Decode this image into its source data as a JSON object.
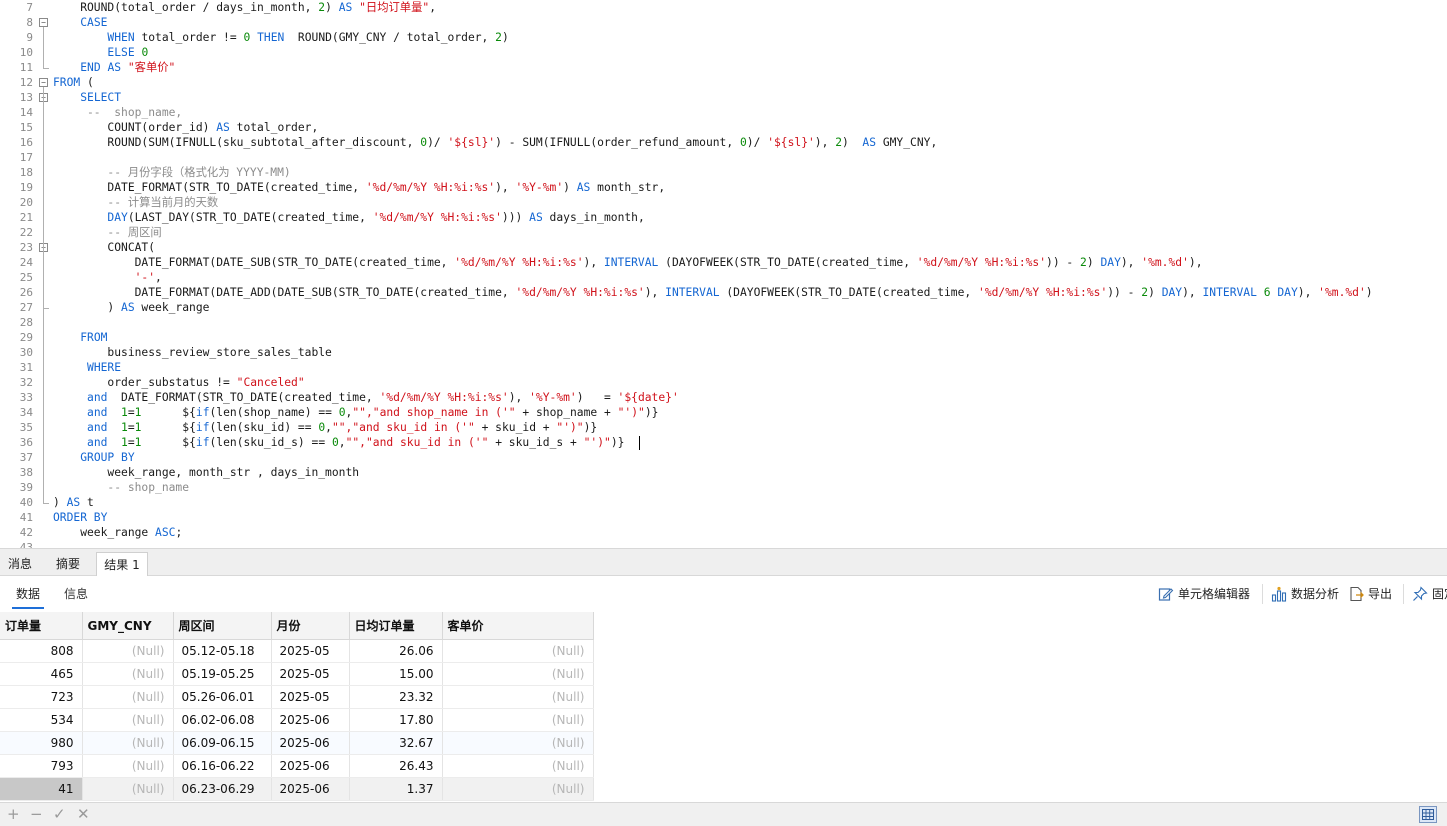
{
  "editor": {
    "lines": [
      {
        "n": "7",
        "segs": [
          {
            "t": "    ROUND(total_order / days_in_month, "
          },
          {
            "t": "2",
            "c": "num"
          },
          {
            "t": ") "
          },
          {
            "t": "AS",
            "c": "kw"
          },
          {
            "t": " "
          },
          {
            "t": "\"日均订单量\"",
            "c": "str"
          },
          {
            "t": ","
          }
        ]
      },
      {
        "n": "8",
        "segs": [
          {
            "t": "    "
          },
          {
            "t": "CASE",
            "c": "kw"
          }
        ]
      },
      {
        "n": "9",
        "segs": [
          {
            "t": "        "
          },
          {
            "t": "WHEN",
            "c": "kw"
          },
          {
            "t": " total_order != "
          },
          {
            "t": "0",
            "c": "num"
          },
          {
            "t": " "
          },
          {
            "t": "THEN",
            "c": "kw"
          },
          {
            "t": "  ROUND(GMY_CNY / total_order, "
          },
          {
            "t": "2",
            "c": "num"
          },
          {
            "t": ")"
          }
        ]
      },
      {
        "n": "10",
        "segs": [
          {
            "t": "        "
          },
          {
            "t": "ELSE",
            "c": "kw"
          },
          {
            "t": " "
          },
          {
            "t": "0",
            "c": "num"
          }
        ]
      },
      {
        "n": "11",
        "segs": [
          {
            "t": "    "
          },
          {
            "t": "END",
            "c": "kw"
          },
          {
            "t": " "
          },
          {
            "t": "AS",
            "c": "kw"
          },
          {
            "t": " "
          },
          {
            "t": "\"客单价\"",
            "c": "str"
          }
        ]
      },
      {
        "n": "12",
        "segs": [
          {
            "t": "FROM",
            "c": "kw"
          },
          {
            "t": " ("
          }
        ]
      },
      {
        "n": "13",
        "segs": [
          {
            "t": "    "
          },
          {
            "t": "SELECT",
            "c": "kw"
          }
        ]
      },
      {
        "n": "14",
        "segs": [
          {
            "t": "     --  shop_name,",
            "c": "cm"
          }
        ]
      },
      {
        "n": "15",
        "segs": [
          {
            "t": "        COUNT(order_id) "
          },
          {
            "t": "AS",
            "c": "kw"
          },
          {
            "t": " total_order,"
          }
        ]
      },
      {
        "n": "16",
        "segs": [
          {
            "t": "        ROUND(SUM(IFNULL(sku_subtotal_after_discount, "
          },
          {
            "t": "0",
            "c": "num"
          },
          {
            "t": ")/ "
          },
          {
            "t": "'${sl}'",
            "c": "str"
          },
          {
            "t": ") - SUM(IFNULL(order_refund_amount, "
          },
          {
            "t": "0",
            "c": "num"
          },
          {
            "t": ")/ "
          },
          {
            "t": "'${sl}'",
            "c": "str"
          },
          {
            "t": "), "
          },
          {
            "t": "2",
            "c": "num"
          },
          {
            "t": ")  "
          },
          {
            "t": "AS",
            "c": "kw"
          },
          {
            "t": " GMY_CNY,"
          }
        ]
      },
      {
        "n": "17",
        "segs": [
          {
            "t": ""
          }
        ]
      },
      {
        "n": "18",
        "segs": [
          {
            "t": "        -- 月份字段（格式化为 YYYY-MM)",
            "c": "cm"
          }
        ]
      },
      {
        "n": "19",
        "segs": [
          {
            "t": "        DATE_FORMAT(STR_TO_DATE(created_time, "
          },
          {
            "t": "'%d/%m/%Y %H:%i:%s'",
            "c": "str"
          },
          {
            "t": "), "
          },
          {
            "t": "'%Y-%m'",
            "c": "str"
          },
          {
            "t": ") "
          },
          {
            "t": "AS",
            "c": "kw"
          },
          {
            "t": " month_str,"
          }
        ]
      },
      {
        "n": "20",
        "segs": [
          {
            "t": "        -- 计算当前月的天数",
            "c": "cm"
          }
        ]
      },
      {
        "n": "21",
        "segs": [
          {
            "t": "        "
          },
          {
            "t": "DAY",
            "c": "kw"
          },
          {
            "t": "(LAST_DAY(STR_TO_DATE(created_time, "
          },
          {
            "t": "'%d/%m/%Y %H:%i:%s'",
            "c": "str"
          },
          {
            "t": "))) "
          },
          {
            "t": "AS",
            "c": "kw"
          },
          {
            "t": " days_in_month,"
          }
        ]
      },
      {
        "n": "22",
        "segs": [
          {
            "t": "        -- 周区间",
            "c": "cm"
          }
        ]
      },
      {
        "n": "23",
        "segs": [
          {
            "t": "        CONCAT("
          }
        ]
      },
      {
        "n": "24",
        "segs": [
          {
            "t": "            DATE_FORMAT(DATE_SUB(STR_TO_DATE(created_time, "
          },
          {
            "t": "'%d/%m/%Y %H:%i:%s'",
            "c": "str"
          },
          {
            "t": "), "
          },
          {
            "t": "INTERVAL",
            "c": "kw"
          },
          {
            "t": " (DAYOFWEEK(STR_TO_DATE(created_time, "
          },
          {
            "t": "'%d/%m/%Y %H:%i:%s'",
            "c": "str"
          },
          {
            "t": ")) - "
          },
          {
            "t": "2",
            "c": "num"
          },
          {
            "t": ") "
          },
          {
            "t": "DAY",
            "c": "kw"
          },
          {
            "t": "), "
          },
          {
            "t": "'%m.%d'",
            "c": "str"
          },
          {
            "t": "),"
          }
        ]
      },
      {
        "n": "25",
        "segs": [
          {
            "t": "            "
          },
          {
            "t": "'-'",
            "c": "str"
          },
          {
            "t": ","
          }
        ]
      },
      {
        "n": "26",
        "segs": [
          {
            "t": "            DATE_FORMAT(DATE_ADD(DATE_SUB(STR_TO_DATE(created_time, "
          },
          {
            "t": "'%d/%m/%Y %H:%i:%s'",
            "c": "str"
          },
          {
            "t": "), "
          },
          {
            "t": "INTERVAL",
            "c": "kw"
          },
          {
            "t": " (DAYOFWEEK(STR_TO_DATE(created_time, "
          },
          {
            "t": "'%d/%m/%Y %H:%i:%s'",
            "c": "str"
          },
          {
            "t": ")) - "
          },
          {
            "t": "2",
            "c": "num"
          },
          {
            "t": ") "
          },
          {
            "t": "DAY",
            "c": "kw"
          },
          {
            "t": "), "
          },
          {
            "t": "INTERVAL",
            "c": "kw"
          },
          {
            "t": " "
          },
          {
            "t": "6",
            "c": "num"
          },
          {
            "t": " "
          },
          {
            "t": "DAY",
            "c": "kw"
          },
          {
            "t": "), "
          },
          {
            "t": "'%m.%d'",
            "c": "str"
          },
          {
            "t": ")"
          }
        ]
      },
      {
        "n": "27",
        "segs": [
          {
            "t": "        ) "
          },
          {
            "t": "AS",
            "c": "kw"
          },
          {
            "t": " week_range"
          }
        ]
      },
      {
        "n": "28",
        "segs": [
          {
            "t": ""
          }
        ]
      },
      {
        "n": "29",
        "segs": [
          {
            "t": "    "
          },
          {
            "t": "FROM",
            "c": "kw"
          }
        ]
      },
      {
        "n": "30",
        "segs": [
          {
            "t": "        business_review_store_sales_table"
          }
        ]
      },
      {
        "n": "31",
        "segs": [
          {
            "t": "     "
          },
          {
            "t": "WHERE",
            "c": "kw"
          }
        ]
      },
      {
        "n": "32",
        "segs": [
          {
            "t": "        order_substatus != "
          },
          {
            "t": "\"Canceled\"",
            "c": "str"
          }
        ]
      },
      {
        "n": "33",
        "segs": [
          {
            "t": "     "
          },
          {
            "t": "and",
            "c": "kw"
          },
          {
            "t": "  DATE_FORMAT(STR_TO_DATE(created_time, "
          },
          {
            "t": "'%d/%m/%Y %H:%i:%s'",
            "c": "str"
          },
          {
            "t": "), "
          },
          {
            "t": "'%Y-%m'",
            "c": "str"
          },
          {
            "t": ")   = "
          },
          {
            "t": "'${date}'",
            "c": "str"
          }
        ]
      },
      {
        "n": "34",
        "segs": [
          {
            "t": "     "
          },
          {
            "t": "and",
            "c": "kw"
          },
          {
            "t": "  "
          },
          {
            "t": "1",
            "c": "num"
          },
          {
            "t": "="
          },
          {
            "t": "1",
            "c": "num"
          },
          {
            "t": "      ${"
          },
          {
            "t": "if",
            "c": "kw"
          },
          {
            "t": "(len(shop_name) == "
          },
          {
            "t": "0",
            "c": "num"
          },
          {
            "t": ","
          },
          {
            "t": "\"\",\"and shop_name in ('\"",
            "c": "str"
          },
          {
            "t": " + shop_name + "
          },
          {
            "t": "\"')\"",
            "c": "str"
          },
          {
            "t": ")}"
          }
        ]
      },
      {
        "n": "35",
        "segs": [
          {
            "t": "     "
          },
          {
            "t": "and",
            "c": "kw"
          },
          {
            "t": "  "
          },
          {
            "t": "1",
            "c": "num"
          },
          {
            "t": "="
          },
          {
            "t": "1",
            "c": "num"
          },
          {
            "t": "      ${"
          },
          {
            "t": "if",
            "c": "kw"
          },
          {
            "t": "(len(sku_id) == "
          },
          {
            "t": "0",
            "c": "num"
          },
          {
            "t": ","
          },
          {
            "t": "\"\",\"and sku_id in ('\"",
            "c": "str"
          },
          {
            "t": " + sku_id + "
          },
          {
            "t": "\"')\"",
            "c": "str"
          },
          {
            "t": ")}"
          }
        ]
      },
      {
        "n": "36",
        "segs": [
          {
            "t": "     "
          },
          {
            "t": "and",
            "c": "kw"
          },
          {
            "t": "  "
          },
          {
            "t": "1",
            "c": "num"
          },
          {
            "t": "="
          },
          {
            "t": "1",
            "c": "num"
          },
          {
            "t": "      ${"
          },
          {
            "t": "if",
            "c": "kw"
          },
          {
            "t": "(len(sku_id_s) == "
          },
          {
            "t": "0",
            "c": "num"
          },
          {
            "t": ","
          },
          {
            "t": "\"\",\"and sku_id in ('\"",
            "c": "str"
          },
          {
            "t": " + sku_id_s + "
          },
          {
            "t": "\"')\"",
            "c": "str"
          },
          {
            "t": ")}"
          }
        ]
      },
      {
        "n": "37",
        "segs": [
          {
            "t": "    "
          },
          {
            "t": "GROUP BY",
            "c": "kw"
          }
        ]
      },
      {
        "n": "38",
        "segs": [
          {
            "t": "        week_range, month_str , days_in_month"
          }
        ]
      },
      {
        "n": "39",
        "segs": [
          {
            "t": "        -- shop_name",
            "c": "cm"
          }
        ]
      },
      {
        "n": "40",
        "segs": [
          {
            "t": ") "
          },
          {
            "t": "AS",
            "c": "kw"
          },
          {
            "t": " t"
          }
        ]
      },
      {
        "n": "41",
        "segs": [
          {
            "t": "ORDER BY",
            "c": "kw"
          }
        ]
      },
      {
        "n": "42",
        "segs": [
          {
            "t": "    week_range "
          },
          {
            "t": "ASC",
            "c": "kw"
          },
          {
            "t": ";"
          }
        ]
      },
      {
        "n": "43",
        "segs": [
          {
            "t": ""
          }
        ]
      }
    ]
  },
  "bottom_tabs": [
    {
      "label": "消息"
    },
    {
      "label": "摘要"
    },
    {
      "label": "结果 1"
    }
  ],
  "sub_tabs": {
    "data": "数据",
    "info": "信息"
  },
  "toolbar": {
    "cell_editor": "单元格编辑器",
    "data_analysis": "数据分析",
    "export": "导出",
    "pin": "固定"
  },
  "grid": {
    "columns": [
      "订单量",
      "GMY_CNY",
      "周区间",
      "月份",
      "日均订单量",
      "客单价"
    ],
    "rows": [
      [
        "808",
        "(Null)",
        "05.12-05.18",
        "2025-05",
        "26.06",
        "(Null)"
      ],
      [
        "465",
        "(Null)",
        "05.19-05.25",
        "2025-05",
        "15.00",
        "(Null)"
      ],
      [
        "723",
        "(Null)",
        "05.26-06.01",
        "2025-05",
        "23.32",
        "(Null)"
      ],
      [
        "534",
        "(Null)",
        "06.02-06.08",
        "2025-06",
        "17.80",
        "(Null)"
      ],
      [
        "980",
        "(Null)",
        "06.09-06.15",
        "2025-06",
        "32.67",
        "(Null)"
      ],
      [
        "793",
        "(Null)",
        "06.16-06.22",
        "2025-06",
        "26.43",
        "(Null)"
      ],
      [
        "41",
        "(Null)",
        "06.23-06.29",
        "2025-06",
        "1.37",
        "(Null)"
      ]
    ]
  },
  "statusbar": {
    "add": "+",
    "remove": "−",
    "apply": "✓",
    "cancel": "✕"
  }
}
